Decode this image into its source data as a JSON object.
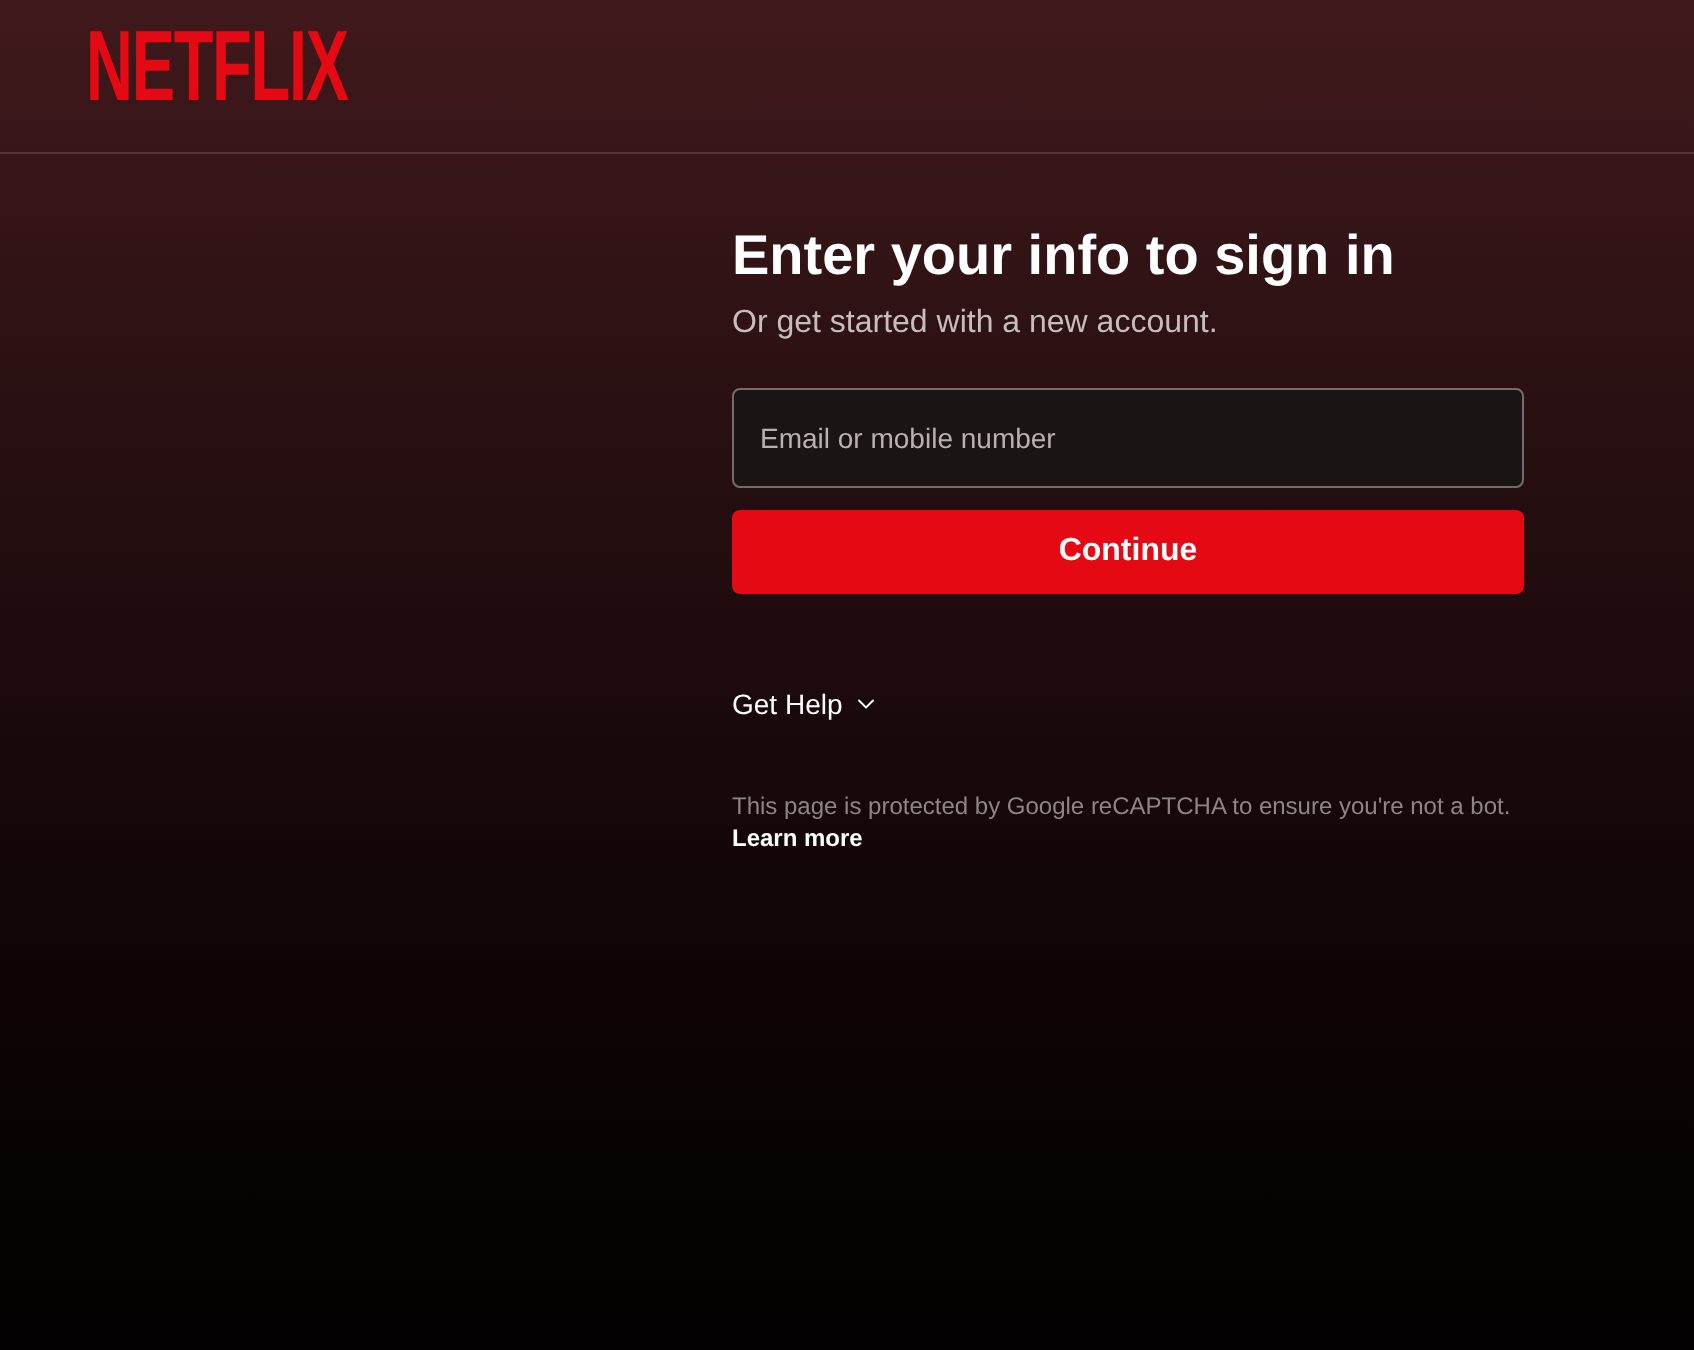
{
  "header": {
    "logo": "NETFLIX"
  },
  "form": {
    "title": "Enter your info to sign in",
    "subtitle": "Or get started with a new account.",
    "email_field": {
      "placeholder": "Email or mobile number"
    },
    "continue_button": "Continue",
    "get_help": {
      "label": "Get Help",
      "expanded": false
    },
    "recaptcha_notice": "This page is protected by Google reCAPTCHA to ensure you're not a bot.",
    "learn_more": "Learn more"
  }
}
